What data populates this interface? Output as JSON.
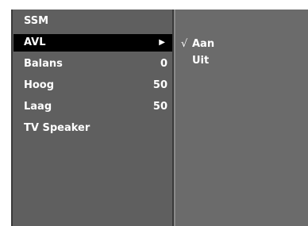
{
  "menu": {
    "items": [
      {
        "label": "SSM",
        "value": ""
      },
      {
        "label": "AVL",
        "value": "",
        "selected": true
      },
      {
        "label": "Balans",
        "value": "0"
      },
      {
        "label": "Hoog",
        "value": "50"
      },
      {
        "label": "Laag",
        "value": "50"
      },
      {
        "label": "TV Speaker",
        "value": ""
      }
    ]
  },
  "submenu": {
    "options": [
      {
        "label": "Aan",
        "checked": true,
        "mark": "√"
      },
      {
        "label": "Uit",
        "checked": false,
        "mark": ""
      }
    ]
  },
  "icons": {
    "submenu_arrow": "triangle-right-icon"
  },
  "colors": {
    "background": "#6b6b6b",
    "menu_background": "#5f5f5f",
    "selected_background": "#000000",
    "text": "#ffffff"
  }
}
